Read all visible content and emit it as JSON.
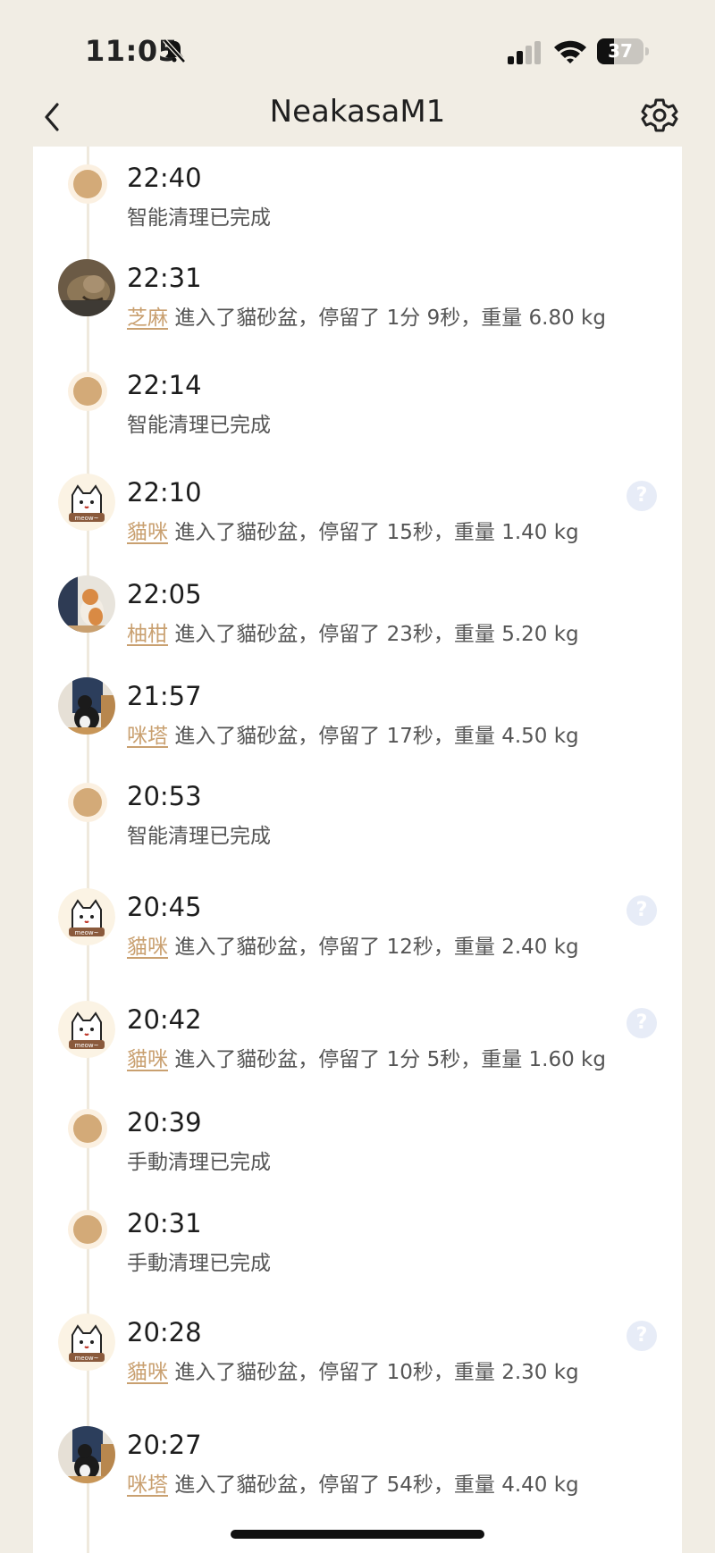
{
  "status": {
    "time": "11:05",
    "battery": "37",
    "battery_level": 0.37
  },
  "header": {
    "title": "NeakasaM1"
  },
  "events": [
    {
      "type": "clean",
      "time": "22:40",
      "message": "智能清理已完成"
    },
    {
      "type": "cat",
      "avatar": "photo-tabby",
      "time": "22:31",
      "name": "芝麻",
      "message": " 進入了貓砂盆，停留了 1分 9秒，重量 6.80 kg",
      "help": false
    },
    {
      "type": "clean",
      "time": "22:14",
      "message": "智能清理已完成"
    },
    {
      "type": "cat",
      "avatar": "meow-cat",
      "time": "22:10",
      "name": "貓咪",
      "message": " 進入了貓砂盆，停留了 15秒，重量 1.40 kg",
      "help": true
    },
    {
      "type": "cat",
      "avatar": "photo-orange",
      "time": "22:05",
      "name": "柚柑",
      "message": " 進入了貓砂盆，停留了 23秒，重量 5.20 kg",
      "help": false
    },
    {
      "type": "cat",
      "avatar": "photo-black",
      "time": "21:57",
      "name": "咪塔",
      "message": " 進入了貓砂盆，停留了 17秒，重量 4.50 kg",
      "help": false
    },
    {
      "type": "clean",
      "time": "20:53",
      "message": "智能清理已完成"
    },
    {
      "type": "cat",
      "avatar": "meow-cat",
      "time": "20:45",
      "name": "貓咪",
      "message": " 進入了貓砂盆，停留了 12秒，重量 2.40 kg",
      "help": true
    },
    {
      "type": "cat",
      "avatar": "meow-cat",
      "time": "20:42",
      "name": "貓咪",
      "message": " 進入了貓砂盆，停留了 1分 5秒，重量 1.60 kg",
      "help": true
    },
    {
      "type": "clean",
      "time": "20:39",
      "message": "手動清理已完成"
    },
    {
      "type": "clean",
      "time": "20:31",
      "message": "手動清理已完成"
    },
    {
      "type": "cat",
      "avatar": "meow-cat",
      "time": "20:28",
      "name": "貓咪",
      "message": " 進入了貓砂盆，停留了 10秒，重量 2.30 kg",
      "help": true
    },
    {
      "type": "cat",
      "avatar": "photo-black",
      "time": "20:27",
      "name": "咪塔",
      "message": " 進入了貓砂盆，停留了 54秒，重量 4.40 kg",
      "help": false
    }
  ],
  "help_icon": "?",
  "colors": {
    "accent": "#c9a070",
    "background": "#f1ede4",
    "card": "#ffffff",
    "help_icon_bg": "#e7ecf7"
  }
}
